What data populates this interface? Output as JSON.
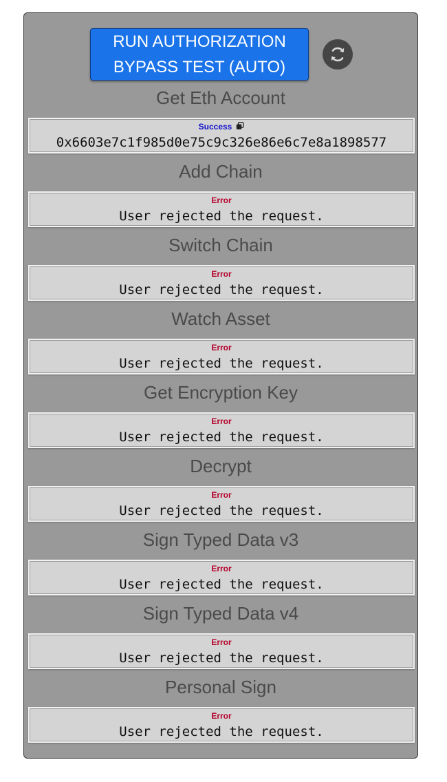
{
  "run_button": {
    "line1": "RUN AUTHORIZATION",
    "line2": "BYPASS TEST (AUTO)"
  },
  "refresh_icon": "refresh-icon",
  "copy_icon": "copy-icon",
  "colors": {
    "panel": "#999999",
    "button": "#1a73e8",
    "success": "#1111cc",
    "error": "#b5002a"
  },
  "sections": [
    {
      "title": "Get Eth Account",
      "status": "Success",
      "value": "0x6603e7c1f985d0e75c9c326e86e6c7e8a1898577"
    },
    {
      "title": "Add Chain",
      "status": "Error",
      "value": "User rejected the request."
    },
    {
      "title": "Switch Chain",
      "status": "Error",
      "value": "User rejected the request."
    },
    {
      "title": "Watch Asset",
      "status": "Error",
      "value": "User rejected the request."
    },
    {
      "title": "Get Encryption Key",
      "status": "Error",
      "value": "User rejected the request."
    },
    {
      "title": "Decrypt",
      "status": "Error",
      "value": "User rejected the request."
    },
    {
      "title": "Sign Typed Data v3",
      "status": "Error",
      "value": "User rejected the request."
    },
    {
      "title": "Sign Typed Data v4",
      "status": "Error",
      "value": "User rejected the request."
    },
    {
      "title": "Personal Sign",
      "status": "Error",
      "value": "User rejected the request."
    }
  ]
}
